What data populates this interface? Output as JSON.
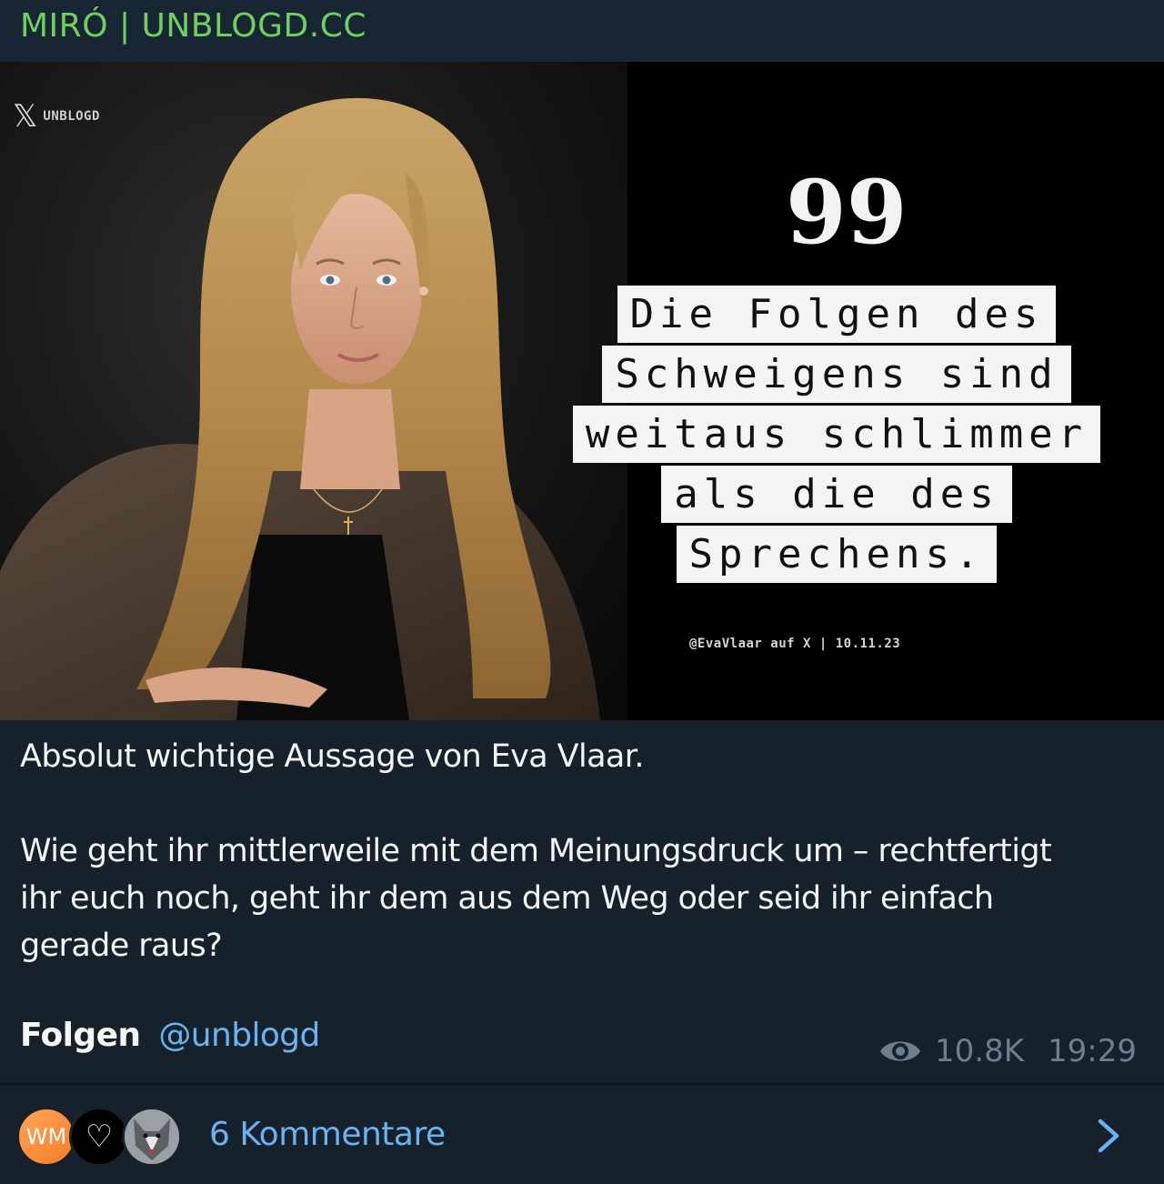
{
  "header": {
    "channel_name": "MIRÓ | UNBLOGD.CC"
  },
  "image": {
    "watermark_handle": "UNBLOGD",
    "quote_mark": "99",
    "quote_lines": [
      "Die Folgen des",
      "Schweigens sind",
      "weitaus schlimmer",
      "als die des",
      "Sprechens."
    ],
    "source": "@EvaVlaar auf X | 10.11.23"
  },
  "post": {
    "line1": "Absolut wichtige Aussage von Eva Vlaar.",
    "line2": "Wie geht ihr mittlerweile mit dem Meinungsdruck um – rechtfertigt",
    "line3": "ihr euch noch, geht ihr dem aus dem Weg oder seid ihr einfach",
    "line4": "gerade raus?",
    "follow_word": "Folgen",
    "mention": "@unblogd",
    "views": "10.8K",
    "time": "19:29"
  },
  "comments": {
    "avatar_initials": "WM",
    "heart_glyph": "♡",
    "label": "6 Kommentare"
  },
  "colors": {
    "background": "#17212b",
    "channel_name": "#6fcf5f",
    "link": "#6ab3f3",
    "meta": "#6d7f8f"
  }
}
